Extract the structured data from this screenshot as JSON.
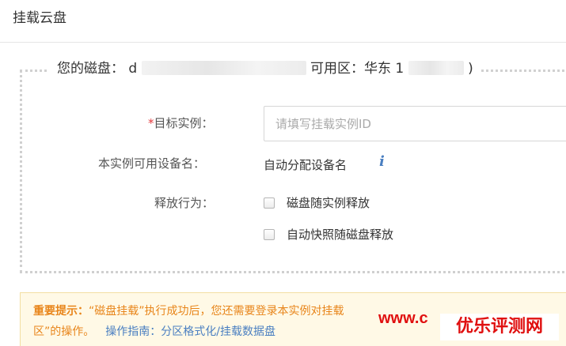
{
  "dialog": {
    "title": "挂载云盘"
  },
  "disk": {
    "label_prefix": "您的磁盘：",
    "id_visible": "d",
    "zone_label": "可用区：华东 1",
    "paren_close": ")"
  },
  "form": {
    "instance": {
      "label": "目标实例：",
      "required_mark": "*",
      "placeholder": "请填写挂载实例ID",
      "value": ""
    },
    "device": {
      "label": "本实例可用设备名：",
      "value": "自动分配设备名",
      "info_glyph": "i"
    },
    "release": {
      "label": "释放行为：",
      "options": [
        {
          "label": "磁盘随实例释放",
          "checked": false
        },
        {
          "label": "自动快照随磁盘释放",
          "checked": false
        }
      ]
    }
  },
  "notice": {
    "label": "重要提示：",
    "text_line1": "“磁盘挂载”执行成功后，您还需要登录本实例对挂载",
    "text_line2": "区”的操作。",
    "guide_label": "操作指南：",
    "guide_link": "分区格式化/挂载数据盘"
  },
  "watermark": {
    "url_part": "www.c",
    "brand": "优乐评测网",
    "color": "#e01010"
  },
  "colors": {
    "accent_blue": "#4a7fc1",
    "notice_orange": "#e8851a",
    "notice_bg": "#fff9e6",
    "required_red": "#e4393c"
  }
}
